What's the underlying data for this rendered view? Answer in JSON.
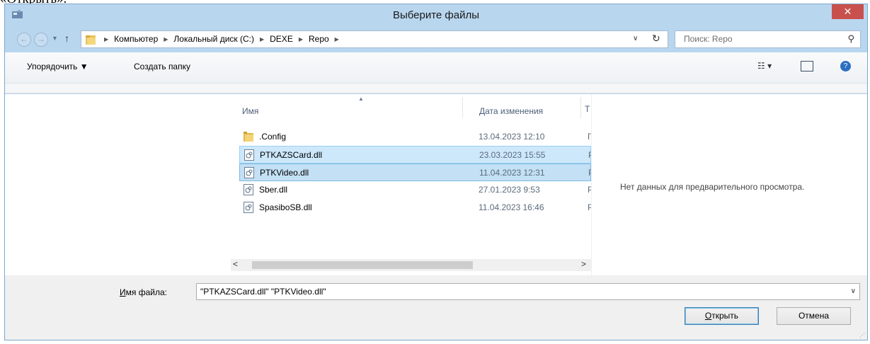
{
  "doc_fragment": "«Открыть».",
  "window": {
    "title": "Выберите файлы",
    "close_label": "✕"
  },
  "address": {
    "breadcrumb": [
      "Компьютер",
      "Локальный диск (C:)",
      "DEXE",
      "Repo"
    ],
    "search_placeholder": "Поиск: Repo"
  },
  "toolbar": {
    "organize_label": "Упорядочить ▼",
    "new_folder_label": "Создать папку",
    "view_label": "☷ ▾"
  },
  "columns": {
    "name": "Имя",
    "date": "Дата изменения",
    "type": "Т"
  },
  "files": [
    {
      "name": ".Config",
      "date": "13.04.2023 12:10",
      "type": "Г",
      "icon": "folder-icon"
    },
    {
      "name": "PTKAZSCard.dll",
      "date": "23.03.2023 15:55",
      "type": "Р",
      "icon": "dll-file-icon"
    },
    {
      "name": "PTKVideo.dll",
      "date": "11.04.2023 12:31",
      "type": "Р",
      "icon": "dll-file-icon"
    },
    {
      "name": "Sber.dll",
      "date": "27.01.2023 9:53",
      "type": "Р",
      "icon": "dll-file-icon"
    },
    {
      "name": "SpasiboSB.dll",
      "date": "11.04.2023 16:46",
      "type": "Р",
      "icon": "dll-file-icon"
    }
  ],
  "preview": {
    "message": "Нет данных для предварительного просмотра."
  },
  "bottom": {
    "filename_label_prefix": "И",
    "filename_label_rest": "мя файла:",
    "filename_value": "\"PTKAZSCard.dll\" \"PTKVideo.dll\"",
    "open_label_prefix": "О",
    "open_label_rest": "ткрыть",
    "cancel_label": "Отмена"
  }
}
